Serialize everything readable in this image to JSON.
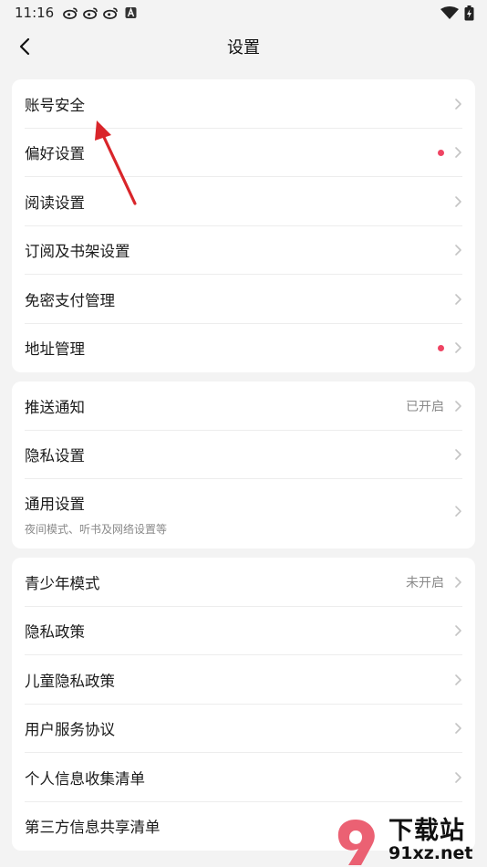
{
  "status_bar": {
    "time": "11:16",
    "notification_icons": [
      "weibo-icon",
      "weibo-icon",
      "weibo-icon",
      "app-a-icon"
    ],
    "right_icons": [
      "wifi-icon",
      "battery-charging-icon"
    ]
  },
  "nav": {
    "title": "设置",
    "back_icon": "chevron-left-icon"
  },
  "group1": [
    {
      "label": "账号安全",
      "dot": false
    },
    {
      "label": "偏好设置",
      "dot": true
    },
    {
      "label": "阅读设置",
      "dot": false
    },
    {
      "label": "订阅及书架设置",
      "dot": false
    },
    {
      "label": "免密支付管理",
      "dot": false
    },
    {
      "label": "地址管理",
      "dot": true
    }
  ],
  "group2": {
    "push": {
      "label": "推送通知",
      "status": "已开启"
    },
    "privacy_settings": {
      "label": "隐私设置"
    },
    "general": {
      "label": "通用设置",
      "sub": "夜间模式、听书及网络设置等"
    }
  },
  "group3": {
    "youth": {
      "label": "青少年模式",
      "status": "未开启"
    },
    "items": [
      "隐私政策",
      "儿童隐私政策",
      "用户服务协议",
      "个人信息收集清单",
      "第三方信息共享清单"
    ]
  },
  "colors": {
    "dot": "#ef4463",
    "annotation_arrow": "#d9252a"
  },
  "watermark": {
    "big": "下载站",
    "small": "91xz.net"
  }
}
